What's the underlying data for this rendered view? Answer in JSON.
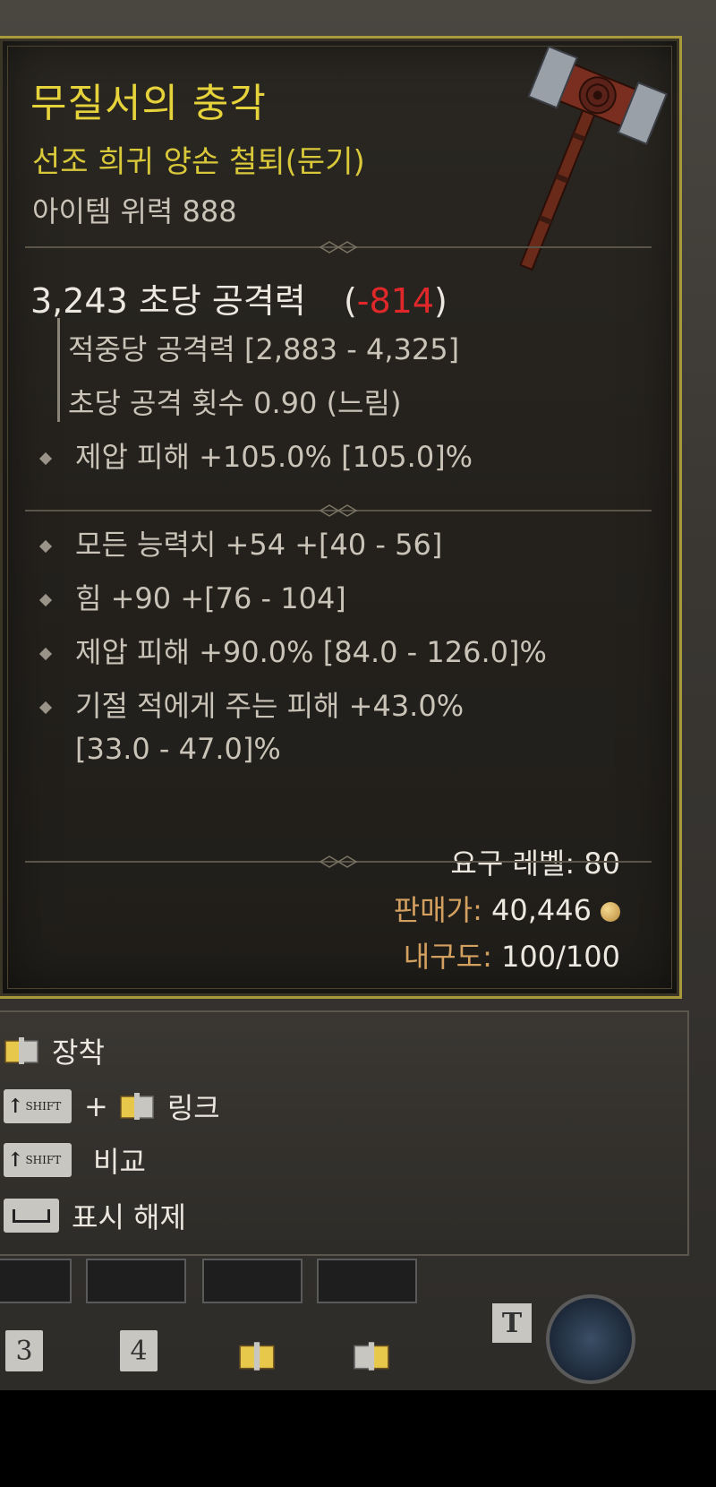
{
  "item": {
    "name": "무질서의 충각",
    "type": "선조 희귀 양손 철퇴(둔기)",
    "power": "아이템 위력 888",
    "dps": "3,243 초당 공격력",
    "dps_delta_open": "(",
    "dps_delta": "-814",
    "dps_delta_close": ")"
  },
  "base_stats": [
    "적중당 공격력 [2,883 - 4,325]",
    "초당 공격 횟수 0.90 (느림)"
  ],
  "implicit": "제압 피해 +105.0% [105.0]%",
  "affixes": [
    "모든 능력치 +54 +[40 - 56]",
    "힘 +90 +[76 - 104]",
    "제압 피해 +90.0% [84.0 - 126.0]%",
    "기절 적에게 주는 피해 +43.0%"
  ],
  "affix_cont": "[33.0 - 47.0]%",
  "requirements": {
    "level": "요구 레벨: 80"
  },
  "sell": {
    "label": "판매가:",
    "value": "40,446"
  },
  "durability": {
    "label": "내구도:",
    "value": "100/100"
  },
  "controls": {
    "equip": "장착",
    "plus": "+",
    "link": "링크",
    "compare": "비교",
    "hide": "표시 해제",
    "shift_key": "SHIFT"
  },
  "hotbar": {
    "key3": "3",
    "key4": "4",
    "tkey": "T"
  },
  "colors": {
    "name": "#e6d23a",
    "negative": "#e0282a",
    "price_label": "#d4a060"
  }
}
